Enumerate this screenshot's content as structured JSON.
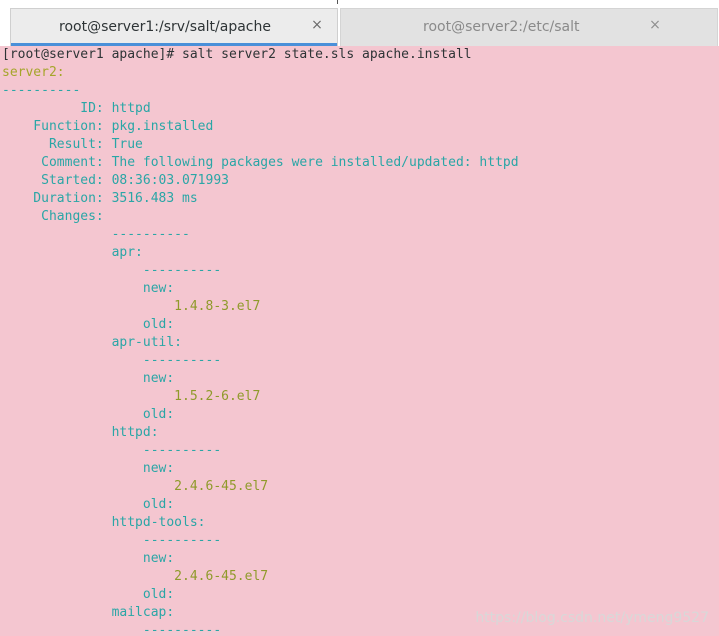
{
  "tabs": [
    {
      "title": "root@server1:/srv/salt/apache",
      "active": true,
      "close": "×"
    },
    {
      "title": "root@server2:/etc/salt",
      "active": false,
      "close": "×"
    }
  ],
  "terminal": {
    "lines": [
      {
        "text": "[root@server1 apache]# salt server2 state.sls apache.install",
        "color": "prompt"
      },
      {
        "text": "server2:",
        "color": "host"
      },
      {
        "text": "----------",
        "color": "cyan"
      },
      {
        "text": "          ID: httpd",
        "color": "cyan"
      },
      {
        "text": "    Function: pkg.installed",
        "color": "cyan"
      },
      {
        "text": "      Result: True",
        "color": "cyan"
      },
      {
        "text": "     Comment: The following packages were installed/updated: httpd",
        "color": "cyan"
      },
      {
        "text": "     Started: 08:36:03.071993",
        "color": "cyan"
      },
      {
        "text": "    Duration: 3516.483 ms",
        "color": "cyan"
      },
      {
        "text": "     Changes:",
        "color": "cyan"
      },
      {
        "text": "              ----------",
        "color": "cyan"
      },
      {
        "text": "              apr:",
        "color": "cyan"
      },
      {
        "text": "                  ----------",
        "color": "cyan"
      },
      {
        "text": "                  new:",
        "color": "cyan"
      },
      {
        "text": "                      1.4.8-3.el7",
        "color": "green"
      },
      {
        "text": "                  old:",
        "color": "cyan"
      },
      {
        "text": "              apr-util:",
        "color": "cyan"
      },
      {
        "text": "                  ----------",
        "color": "cyan"
      },
      {
        "text": "                  new:",
        "color": "cyan"
      },
      {
        "text": "                      1.5.2-6.el7",
        "color": "green"
      },
      {
        "text": "                  old:",
        "color": "cyan"
      },
      {
        "text": "              httpd:",
        "color": "cyan"
      },
      {
        "text": "                  ----------",
        "color": "cyan"
      },
      {
        "text": "                  new:",
        "color": "cyan"
      },
      {
        "text": "                      2.4.6-45.el7",
        "color": "green"
      },
      {
        "text": "                  old:",
        "color": "cyan"
      },
      {
        "text": "              httpd-tools:",
        "color": "cyan"
      },
      {
        "text": "                  ----------",
        "color": "cyan"
      },
      {
        "text": "                  new:",
        "color": "cyan"
      },
      {
        "text": "                      2.4.6-45.el7",
        "color": "green"
      },
      {
        "text": "                  old:",
        "color": "cyan"
      },
      {
        "text": "              mailcap:",
        "color": "cyan"
      },
      {
        "text": "                  ----------",
        "color": "cyan"
      }
    ]
  },
  "watermark": "https://blog.csdn.net/ymeng9527",
  "colors": {
    "background": "#f4c6d0",
    "prompt": "#2e3436",
    "host": "#a5a52a",
    "cyan": "#2aa6a6",
    "green": "#4e9a06"
  }
}
